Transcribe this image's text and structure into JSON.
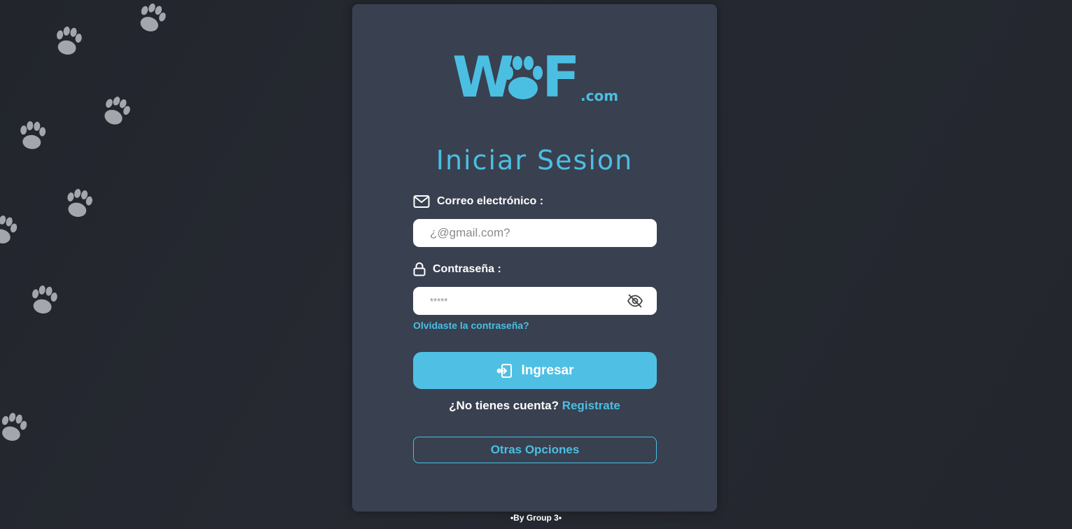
{
  "brand": {
    "logo_main_left": "W",
    "logo_main_right": "F",
    "logo_suffix": ".com",
    "color": "#4bbfe2"
  },
  "login": {
    "title": "Iniciar Sesion",
    "email_label": "Correo electrónico :",
    "email_placeholder": "¿@gmail.com?",
    "email_icon": "mail-icon",
    "password_label": "Contraseña :",
    "password_value": "*****",
    "password_icon": "lock-icon",
    "toggle_icon": "eye-off-icon",
    "forgot_link": "Olvidaste la contraseña?",
    "submit_label": "Ingresar",
    "submit_icon": "login-icon",
    "no_account_text": "¿No tienes cuenta?",
    "register_link": "Registrate",
    "other_options_label": "Otras Opciones"
  },
  "footer": {
    "credit": "•By Group 3•"
  },
  "colors": {
    "background": "#24272e",
    "card": "#394050",
    "accent": "#4fc0e4",
    "paw": "#a3a6ab"
  }
}
